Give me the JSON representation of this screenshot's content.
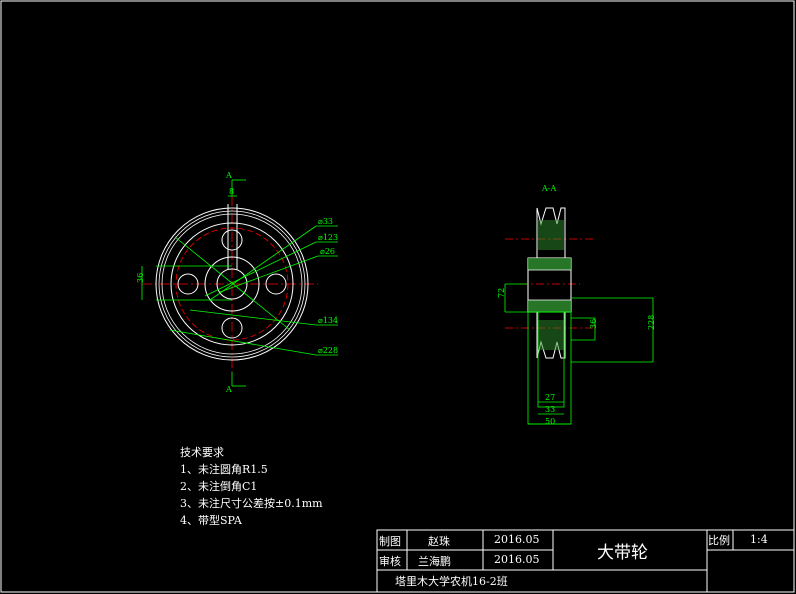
{
  "drawing": {
    "front_view": {
      "section_label": "A",
      "diameters": [
        "⌀33",
        "⌀123",
        "⌀26",
        "⌀134",
        "⌀228"
      ],
      "dims": {
        "keyway_width": "8",
        "left": "36"
      }
    },
    "section_view": {
      "title": "A-A",
      "dims": {
        "bore": "72",
        "hub": "36",
        "outer": "228",
        "groove": "27",
        "hub_width": "33",
        "total_width": "50"
      }
    },
    "tech_requirements": {
      "title": "技术要求",
      "items": [
        "1、未注圆角R1.5",
        "2、未注倒角C1",
        "3、未注尺寸公差按±0.1mm",
        "4、带型SPA"
      ]
    },
    "title_block": {
      "drawn_label": "制图",
      "drawn_by": "赵珠",
      "drawn_date": "2016.05",
      "checked_label": "审核",
      "checked_by": "兰海鹏",
      "checked_date": "2016.05",
      "part_name": "大带轮",
      "scale_label": "比例",
      "scale_value": "1:4",
      "school": "塔里木大学农机16-2班"
    }
  },
  "colors": {
    "background": "#000000",
    "outline": "#ffffff",
    "dim": "#00ff00",
    "center": "#ff0000",
    "hatch": "#00ff00"
  }
}
